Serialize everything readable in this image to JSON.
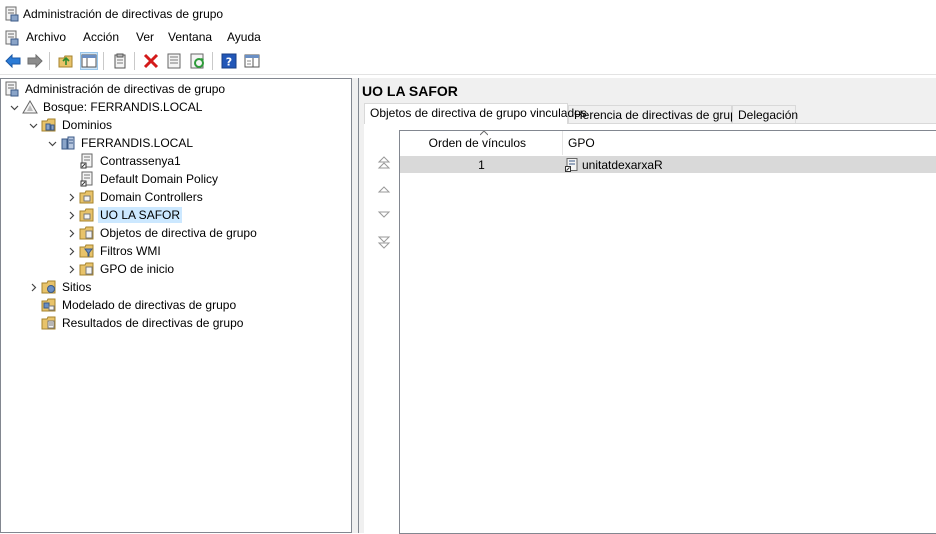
{
  "window": {
    "title": "Administración de directivas de grupo"
  },
  "menu": [
    "Archivo",
    "Acción",
    "Ver",
    "Ventana",
    "Ayuda"
  ],
  "toolbar": [
    {
      "icon": "back-arrow-icon"
    },
    {
      "icon": "forward-arrow-icon"
    },
    {
      "icon": "up-folder-icon"
    },
    {
      "icon": "show-hide-tree-icon"
    },
    {
      "icon": "clipboard-icon"
    },
    {
      "icon": "delete-icon"
    },
    {
      "icon": "properties-icon"
    },
    {
      "icon": "refresh-icon"
    },
    {
      "icon": "help-icon"
    },
    {
      "icon": "console-view-icon"
    }
  ],
  "tree": {
    "root": "Administración de directivas de grupo",
    "forest": "Bosque: FERRANDIS.LOCAL",
    "domains": "Dominios",
    "domain": "FERRANDIS.LOCAL",
    "children": [
      "Contrassenya1",
      "Default Domain Policy",
      "Domain Controllers",
      "UO LA SAFOR",
      "Objetos de directiva de grupo",
      "Filtros WMI",
      "GPO de inicio"
    ],
    "sites": "Sitios",
    "modeling": "Modelado de directivas de grupo",
    "results": "Resultados de directivas de grupo",
    "selected": "UO LA SAFOR"
  },
  "right": {
    "title": "UO LA SAFOR",
    "tabs": [
      "Objetos de directiva de grupo vinculados",
      "Herencia de directivas de grupo",
      "Delegación"
    ],
    "active_tab": 0,
    "columns": {
      "order": "Orden de vínculos",
      "gpo": "GPO"
    },
    "rows": [
      {
        "order": "1",
        "gpo": "unitatdexarxaR"
      }
    ]
  },
  "colors": {
    "selection": "#cce8ff",
    "row_selected": "#d9d9d9",
    "pane_bg": "#f0f0f0"
  }
}
